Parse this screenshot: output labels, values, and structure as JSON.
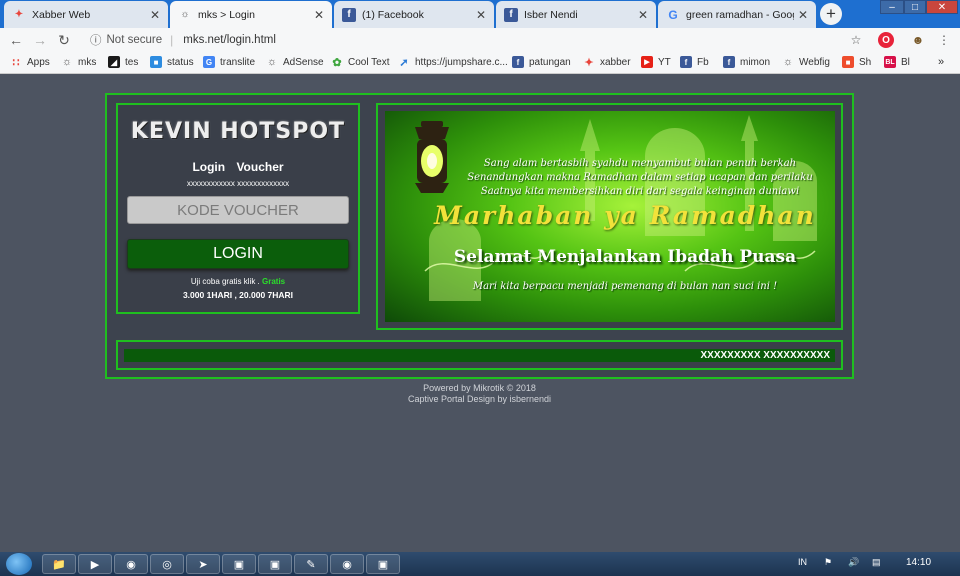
{
  "browser": {
    "tabs": [
      {
        "title": "Xabber Web",
        "favicon": "xabber-icon",
        "color": "#e8453c"
      },
      {
        "title": "mks > Login",
        "favicon": "mikrotik-icon",
        "color": "#555555"
      },
      {
        "title": "(1) Facebook",
        "favicon": "facebook-icon",
        "color": "#3b5998"
      },
      {
        "title": "Isber Nendi",
        "favicon": "facebook-icon",
        "color": "#3b5998"
      },
      {
        "title": "green ramadhan - Google S",
        "favicon": "google-icon",
        "color": "#4285f4"
      }
    ],
    "active_tab": 1,
    "security_label": "Not secure",
    "url": "mks.net/login.html"
  },
  "bookmarks": [
    {
      "label": "Apps",
      "icon": "apps-grid-icon",
      "color": "#e8453c"
    },
    {
      "label": "mks",
      "icon": "mikrotik-icon",
      "color": "#555555"
    },
    {
      "label": "tes",
      "icon": "tes-icon",
      "color": "#1a1a1a"
    },
    {
      "label": "status",
      "icon": "status-icon",
      "color": "#2d8ce0"
    },
    {
      "label": "translite",
      "icon": "translate-icon",
      "color": "#4285f4"
    },
    {
      "label": "AdSense",
      "icon": "mikrotik-icon",
      "color": "#555555"
    },
    {
      "label": "Cool Text",
      "icon": "cooltext-icon",
      "color": "#3fa63f"
    },
    {
      "label": "https://jumpshare.c...",
      "icon": "jumpshare-icon",
      "color": "#2b7bd6"
    },
    {
      "label": "patungan",
      "icon": "facebook-icon",
      "color": "#3b5998"
    },
    {
      "label": "xabber",
      "icon": "xabber-icon",
      "color": "#e8453c"
    },
    {
      "label": "YT",
      "icon": "youtube-icon",
      "color": "#e62117"
    },
    {
      "label": "Fb",
      "icon": "facebook-icon",
      "color": "#3b5998"
    },
    {
      "label": "mimon",
      "icon": "facebook-icon",
      "color": "#3b5998"
    },
    {
      "label": "Webfig",
      "icon": "mikrotik-icon",
      "color": "#555555"
    },
    {
      "label": "Sh",
      "icon": "shop-icon",
      "color": "#ee4d2d"
    },
    {
      "label": "Bl",
      "icon": "bukalapak-icon",
      "color": "#d71149"
    }
  ],
  "login": {
    "brand": "KEVIN HOTSPOT",
    "tab_login": "Login",
    "tab_voucher": "Voucher",
    "masked_info": "xxxxxxxxxxxx xxxxxxxxxxxxx",
    "voucher_placeholder": "KODE VOUCHER",
    "login_button": "LOGIN",
    "trial_text": "Uji coba gratis klik",
    "trial_link": "Gratis",
    "prices": "3.000 1HARI , 20.000 7HARI"
  },
  "banner": {
    "line1": "Sang alam bertasbih syahdu menyambut bulan penuh berkah",
    "line2": "Senandungkan makna Ramadhan dalam setiap ucapan dan perilaku",
    "line3": "Saatnya kita membersihkan diri dari segala keinginan duniawi",
    "headline": "Marhaban ya Ramadhan",
    "greeting": "Selamat Menjalankan Ibadah Puasa",
    "footer_line": "Mari kita berpacu menjadi pemenang di bulan nan suci ini !"
  },
  "marquee": {
    "text": "XXXXXXXXX XXXXXXXXXX"
  },
  "footer": {
    "powered": "Powered by Mikrotik © 2018",
    "design": "Captive Portal Design by isbernendi"
  },
  "taskbar": {
    "language": "IN",
    "time": "14:10"
  }
}
